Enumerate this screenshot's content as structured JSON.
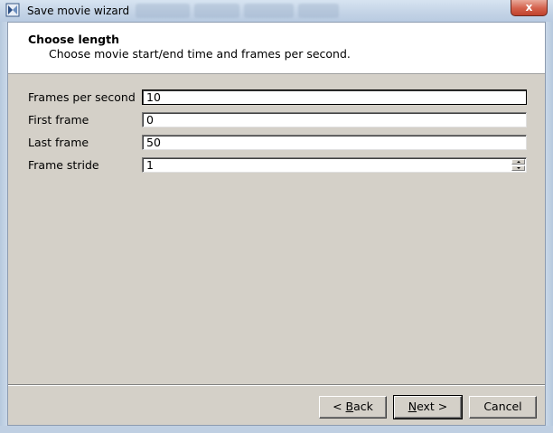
{
  "window": {
    "title": "Save movie wizard",
    "close_glyph": "x"
  },
  "header": {
    "title": "Choose length",
    "subtitle": "Choose movie start/end time and frames per second."
  },
  "form": {
    "fields": [
      {
        "label": "Frames per second",
        "value": "10"
      },
      {
        "label": "First frame",
        "value": "0"
      },
      {
        "label": "Last frame",
        "value": "50"
      },
      {
        "label": "Frame stride",
        "value": "1"
      }
    ]
  },
  "buttons": {
    "back": {
      "prefix": "< ",
      "mnemonic": "B",
      "rest": "ack"
    },
    "next": {
      "mnemonic": "N",
      "rest": "ext >"
    },
    "cancel": "Cancel"
  },
  "icons": {
    "app": "wizard-app-icon",
    "spin_up": "spin-up-arrow-icon",
    "spin_down": "spin-down-arrow-icon"
  },
  "colors": {
    "dialog_bg": "#d4d0c8",
    "header_bg": "#ffffff",
    "close_button": "#c0432d"
  }
}
